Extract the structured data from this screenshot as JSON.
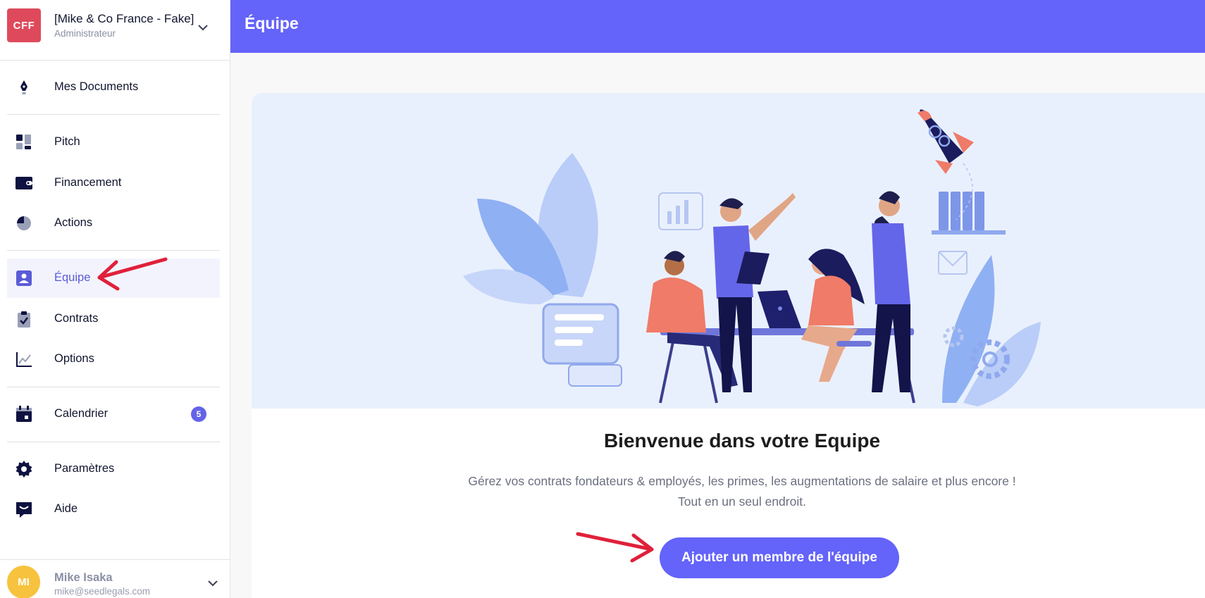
{
  "company": {
    "initials": "CFF",
    "name": "[Mike & Co France - Fake]",
    "role": "Administrateur"
  },
  "nav": {
    "documents": "Mes Documents",
    "pitch": "Pitch",
    "financement": "Financement",
    "actions": "Actions",
    "equipe": "Équipe",
    "contrats": "Contrats",
    "options": "Options",
    "calendrier": "Calendrier",
    "calendrier_badge": "5",
    "parametres": "Paramètres",
    "aide": "Aide"
  },
  "user": {
    "initials": "MI",
    "name": "Mike Isaka",
    "email": "mike@seedlegals.com"
  },
  "header": {
    "title": "Équipe"
  },
  "main": {
    "welcome_title": "Bienvenue dans votre Equipe",
    "welcome_line1": "Gérez vos contrats fondateurs & employés, les primes, les augmentations de salaire et plus encore !",
    "welcome_line2": "Tout en un seul endroit.",
    "add_button": "Ajouter un membre de l'équipe"
  },
  "colors": {
    "accent": "#6463fa",
    "annotation_arrow": "#e0203a",
    "logo": "#de4a5c",
    "avatar": "#f7c23e"
  }
}
